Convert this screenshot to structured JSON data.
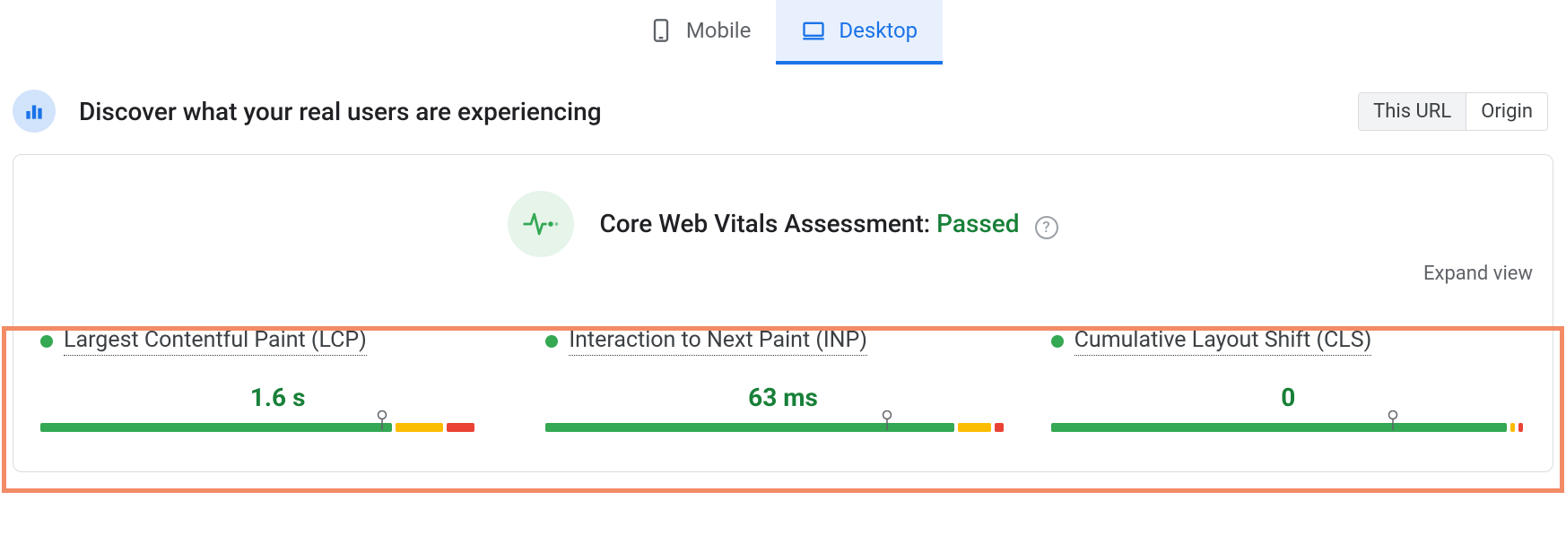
{
  "tabs": {
    "mobile_label": "Mobile",
    "desktop_label": "Desktop"
  },
  "header": {
    "title": "Discover what your real users are experiencing",
    "scope": {
      "this_url": "This URL",
      "origin": "Origin"
    }
  },
  "assessment": {
    "label_prefix": "Core Web Vitals Assessment: ",
    "status": "Passed"
  },
  "expand_label": "Expand view",
  "metrics": [
    {
      "name": "Largest Contentful Paint (LCP)",
      "value": "1.6 s",
      "bar": {
        "green_pct": 74,
        "orange_pct": 10,
        "red_pct": 6,
        "marker_pct": 72
      }
    },
    {
      "name": "Interaction to Next Paint (INP)",
      "value": "63 ms",
      "bar": {
        "green_pct": 86,
        "orange_pct": 7,
        "red_pct": 2,
        "marker_pct": 72
      }
    },
    {
      "name": "Cumulative Layout Shift (CLS)",
      "value": "0",
      "bar": {
        "green_pct": 96,
        "orange_pct": 1,
        "red_pct": 1,
        "marker_pct": 72
      }
    }
  ]
}
